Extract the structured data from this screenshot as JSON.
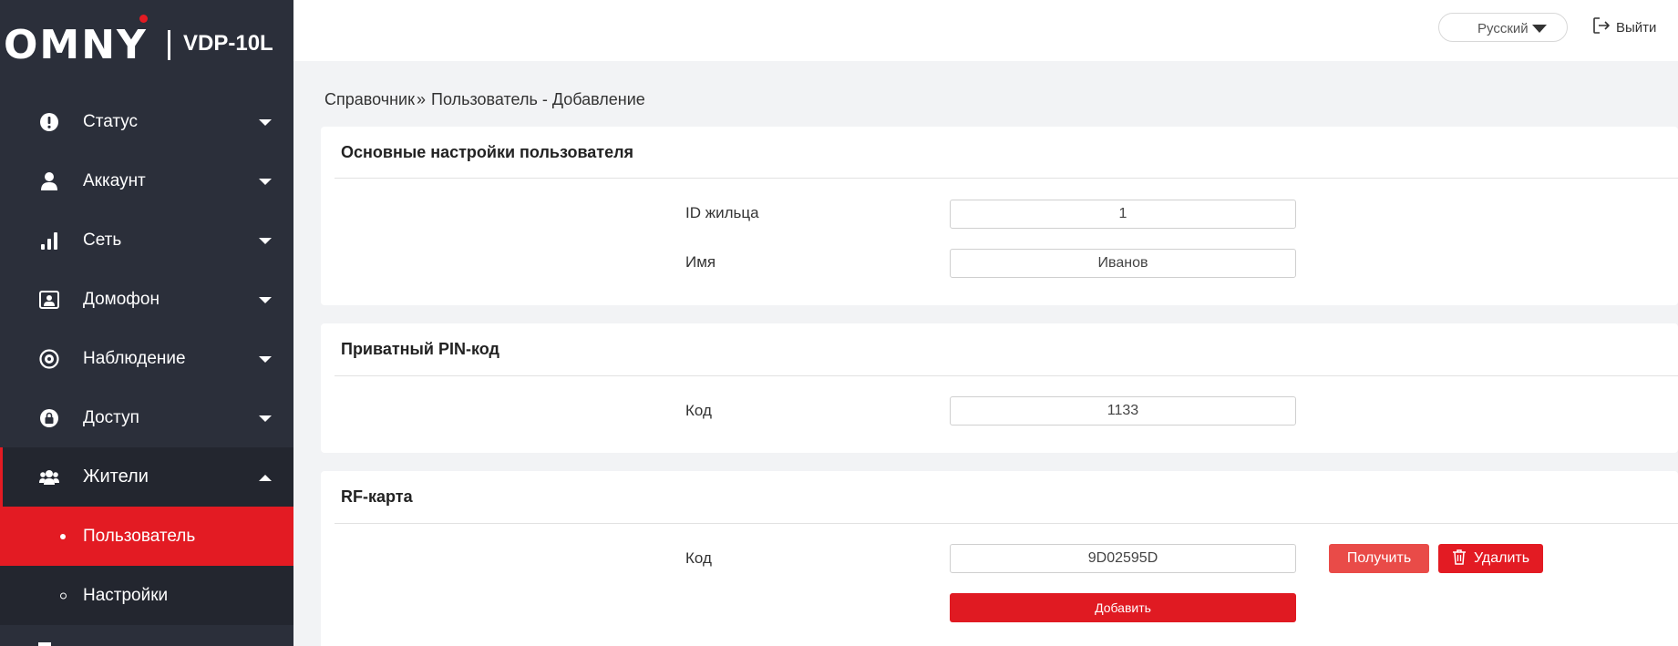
{
  "brand": {
    "logo": "OMNY",
    "model": "VDP-10L"
  },
  "colors": {
    "accent": "#e31b23",
    "sidebar_bg": "#2b2f3a",
    "sidebar_dark": "#23262f",
    "get_button": "#e94b48"
  },
  "sidebar": {
    "items": [
      {
        "label": "Статус",
        "icon": "info-icon"
      },
      {
        "label": "Аккаунт",
        "icon": "user-icon"
      },
      {
        "label": "Сеть",
        "icon": "signal-bars-icon"
      },
      {
        "label": "Домофон",
        "icon": "intercom-icon"
      },
      {
        "label": "Наблюдение",
        "icon": "eye-icon"
      },
      {
        "label": "Доступ",
        "icon": "lock-icon"
      },
      {
        "label": "Жители",
        "icon": "residents-icon"
      }
    ],
    "subitems": [
      {
        "label": "Пользователь",
        "active": true
      },
      {
        "label": "Настройки",
        "active": false
      }
    ]
  },
  "header": {
    "language": "Русский",
    "logout": "Выйти"
  },
  "breadcrumb": {
    "parent": "Справочник",
    "separator": "»",
    "current": "Пользователь - Добавление"
  },
  "basic": {
    "title": "Основные настройки пользователя",
    "fields": [
      {
        "label": "ID жильца",
        "value": "1"
      },
      {
        "label": "Имя",
        "value": "Иванов"
      }
    ]
  },
  "pin": {
    "title": "Приватный PIN-код",
    "label": "Код",
    "value": "1133"
  },
  "rf": {
    "title": "RF-карта",
    "label": "Код",
    "value": "9D02595D",
    "get_label": "Получить",
    "delete_label": "Удалить",
    "add_label": "Добавить"
  }
}
